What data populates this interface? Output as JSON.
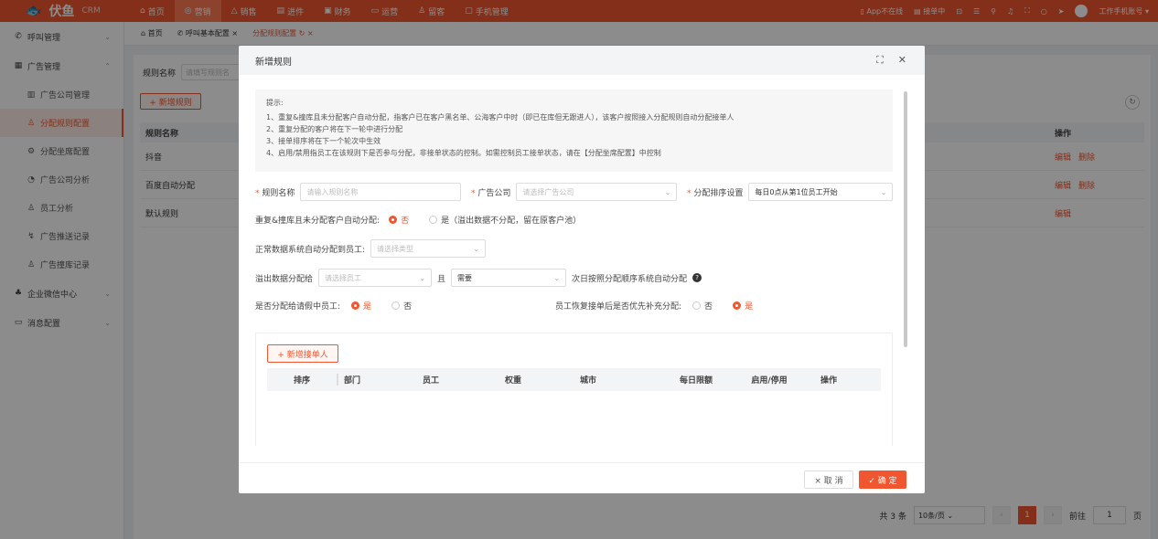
{
  "brand": {
    "name": "伏鱼",
    "suffix": "CRM"
  },
  "nav": [
    "首页",
    "营销",
    "销售",
    "进件",
    "财务",
    "运营",
    "留客",
    "手机管理"
  ],
  "topright": {
    "app": "App不在线",
    "order": "接单中",
    "user": "工作手机账号"
  },
  "sidebar": {
    "call": "呼叫管理",
    "ad": "广告管理",
    "items": [
      "广告公司管理",
      "分配规则配置",
      "分配坐席配置",
      "广告公司分析",
      "员工分析",
      "广告推送记录",
      "广告撞库记录"
    ],
    "wecom": "企业微信中心",
    "msg": "消息配置"
  },
  "tabs": [
    "首页",
    "呼叫基本配置",
    "分配规则配置"
  ],
  "filter": {
    "label": "规则名称",
    "placeholder": "请填写规则名"
  },
  "add_rule": "+ 新增规则",
  "table": {
    "h1": "规则名称",
    "h2": "操作",
    "rows": [
      {
        "name": "抖音",
        "edit": "编辑",
        "del": "删除"
      },
      {
        "name": "百度自动分配",
        "edit": "编辑",
        "del": "删除"
      },
      {
        "name": "默认规则",
        "edit": "编辑",
        "del": ""
      }
    ]
  },
  "pager": {
    "total": "共 3 条",
    "size": "10条/页",
    "page": "1",
    "goto": "前往",
    "jump": "1",
    "unit": "页"
  },
  "modal": {
    "title": "新增规则",
    "tip_title": "提示:",
    "tips": [
      "1、重复&撞库且未分配客户自动分配，指客户已在客户黑名单、公海客户中时（即已在库但无跟进人），该客户按照接入分配规则自动分配接单人",
      "2、重复分配的客户将在下一轮中进行分配",
      "3、接单排序将在下一个轮次中生效",
      "4、启用/禁用指员工在该规则下是否参与分配，非接单状态的控制。如需控制员工接单状态，请在【分配坐席配置】中控制"
    ],
    "rule_name": {
      "label": "规则名称",
      "placeholder": "请输入规则名称"
    },
    "company": {
      "label": "广告公司",
      "placeholder": "请选择广告公司"
    },
    "sort": {
      "label": "分配排序设置",
      "value": "每日0点从第1位员工开始"
    },
    "dup": {
      "label": "重复&撞库且未分配客户自动分配:",
      "no": "否",
      "yes": "是（溢出数据不分配，留在原客户池）"
    },
    "normal": {
      "label": "正常数据系统自动分配到员工:",
      "placeholder": "请选择类型"
    },
    "overflow": {
      "label": "溢出数据分配给",
      "placeholder": "请选择员工",
      "and": "且",
      "need": "需要",
      "suffix": "次日按照分配顺序系统自动分配"
    },
    "leave": {
      "label": "是否分配给请假中员工:",
      "yes": "是",
      "no": "否"
    },
    "resume": {
      "label": "员工恢复接单后是否优先补充分配:",
      "no": "否",
      "yes": "是"
    },
    "add_taker": "+ 新增接单人",
    "cols": [
      "排序",
      "部门",
      "员工",
      "权重",
      "城市",
      "每日限额",
      "启用/停用",
      "操作"
    ],
    "cancel": "× 取 消",
    "ok": "✓ 确 定"
  }
}
